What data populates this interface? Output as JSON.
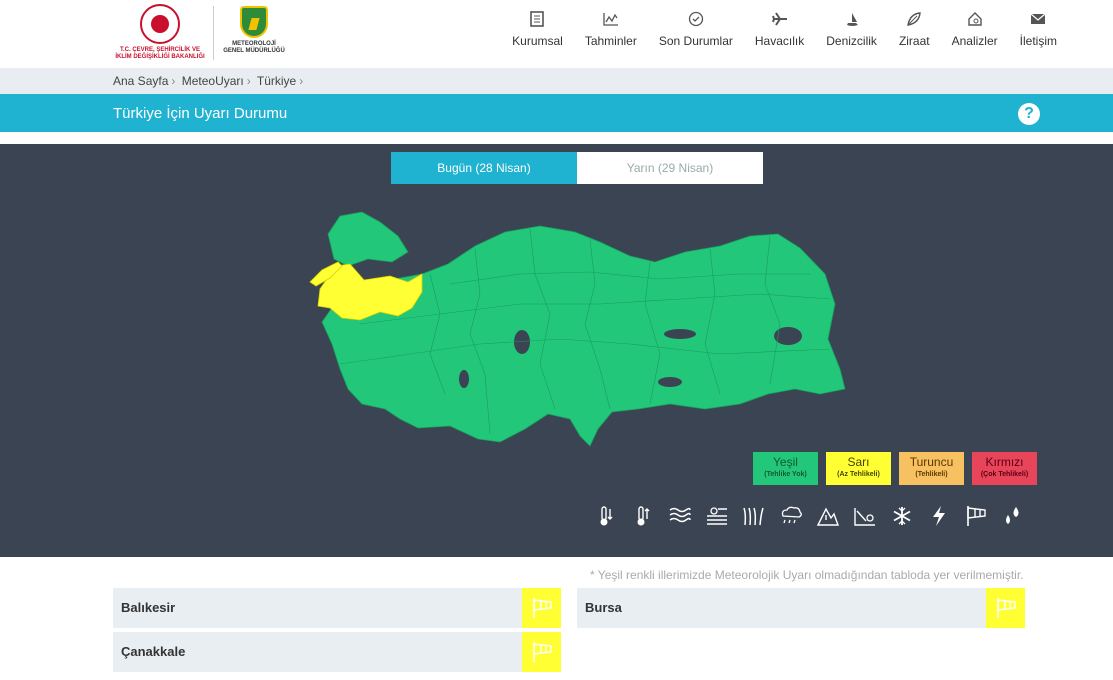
{
  "header": {
    "ministry_logo_text": "T.C. ÇEVRE, ŞEHİRCİLİK VE\nİKLİM DEĞİŞİKLİĞİ BAKANLIĞI",
    "mgm_logo_text": "METEOROLOJİ\nGENEL MÜDÜRLÜĞÜ",
    "nav": [
      {
        "label": "Kurumsal",
        "icon": "document-icon"
      },
      {
        "label": "Tahminler",
        "icon": "chart-icon"
      },
      {
        "label": "Son Durumlar",
        "icon": "clock-icon"
      },
      {
        "label": "Havacılık",
        "icon": "plane-icon"
      },
      {
        "label": "Denizcilik",
        "icon": "ship-icon"
      },
      {
        "label": "Ziraat",
        "icon": "leaf-icon"
      },
      {
        "label": "Analizler",
        "icon": "analysis-icon"
      },
      {
        "label": "İletişim",
        "icon": "mail-icon"
      }
    ]
  },
  "breadcrumb": [
    "Ana Sayfa",
    "MeteoUyarı",
    "Türkiye"
  ],
  "page_title": "Türkiye İçin Uyarı Durumu",
  "help_label": "?",
  "tabs": [
    {
      "label": "Bugün (28 Nisan)",
      "active": true
    },
    {
      "label": "Yarın (29 Nisan)",
      "active": false
    }
  ],
  "colors": {
    "accent": "#1fb3d1",
    "panel": "#3b4452",
    "green": "#22c77a",
    "yellow": "#ffff33",
    "orange": "#f7c060",
    "red": "#e8455a"
  },
  "legend": [
    {
      "name": "Yeşil",
      "desc": "(Tehlike Yok)",
      "color": "#22c77a",
      "text_color": "#145a2f"
    },
    {
      "name": "Sarı",
      "desc": "(Az Tehlikeli)",
      "color": "#ffff33",
      "text_color": "#444400"
    },
    {
      "name": "Turuncu",
      "desc": "(Tehlikeli)",
      "color": "#f7c060",
      "text_color": "#5a3a00"
    },
    {
      "name": "Kırmızı",
      "desc": "(Çok Tehlikeli)",
      "color": "#e8455a",
      "text_color": "#5a0010"
    }
  ],
  "hazard_icons": [
    "cold-thermometer-icon",
    "hot-thermometer-icon",
    "fog-waves-icon",
    "dust-icon",
    "wind-grass-icon",
    "rain-snow-icon",
    "avalanche-icon",
    "landslide-icon",
    "snowflake-icon",
    "lightning-icon",
    "wind-flag-icon",
    "rain-drops-icon"
  ],
  "note": "* Yeşil renkli illerimizde Meteorolojik Uyarı olmadığından tabloda yer verilmemiştir.",
  "provinces": [
    {
      "name": "Balıkesir",
      "hazard": "wind-flag-icon",
      "level_color": "#ffff33"
    },
    {
      "name": "Bursa",
      "hazard": "wind-flag-icon",
      "level_color": "#ffff33"
    },
    {
      "name": "Çanakkale",
      "hazard": "wind-flag-icon",
      "level_color": "#ffff33"
    }
  ]
}
